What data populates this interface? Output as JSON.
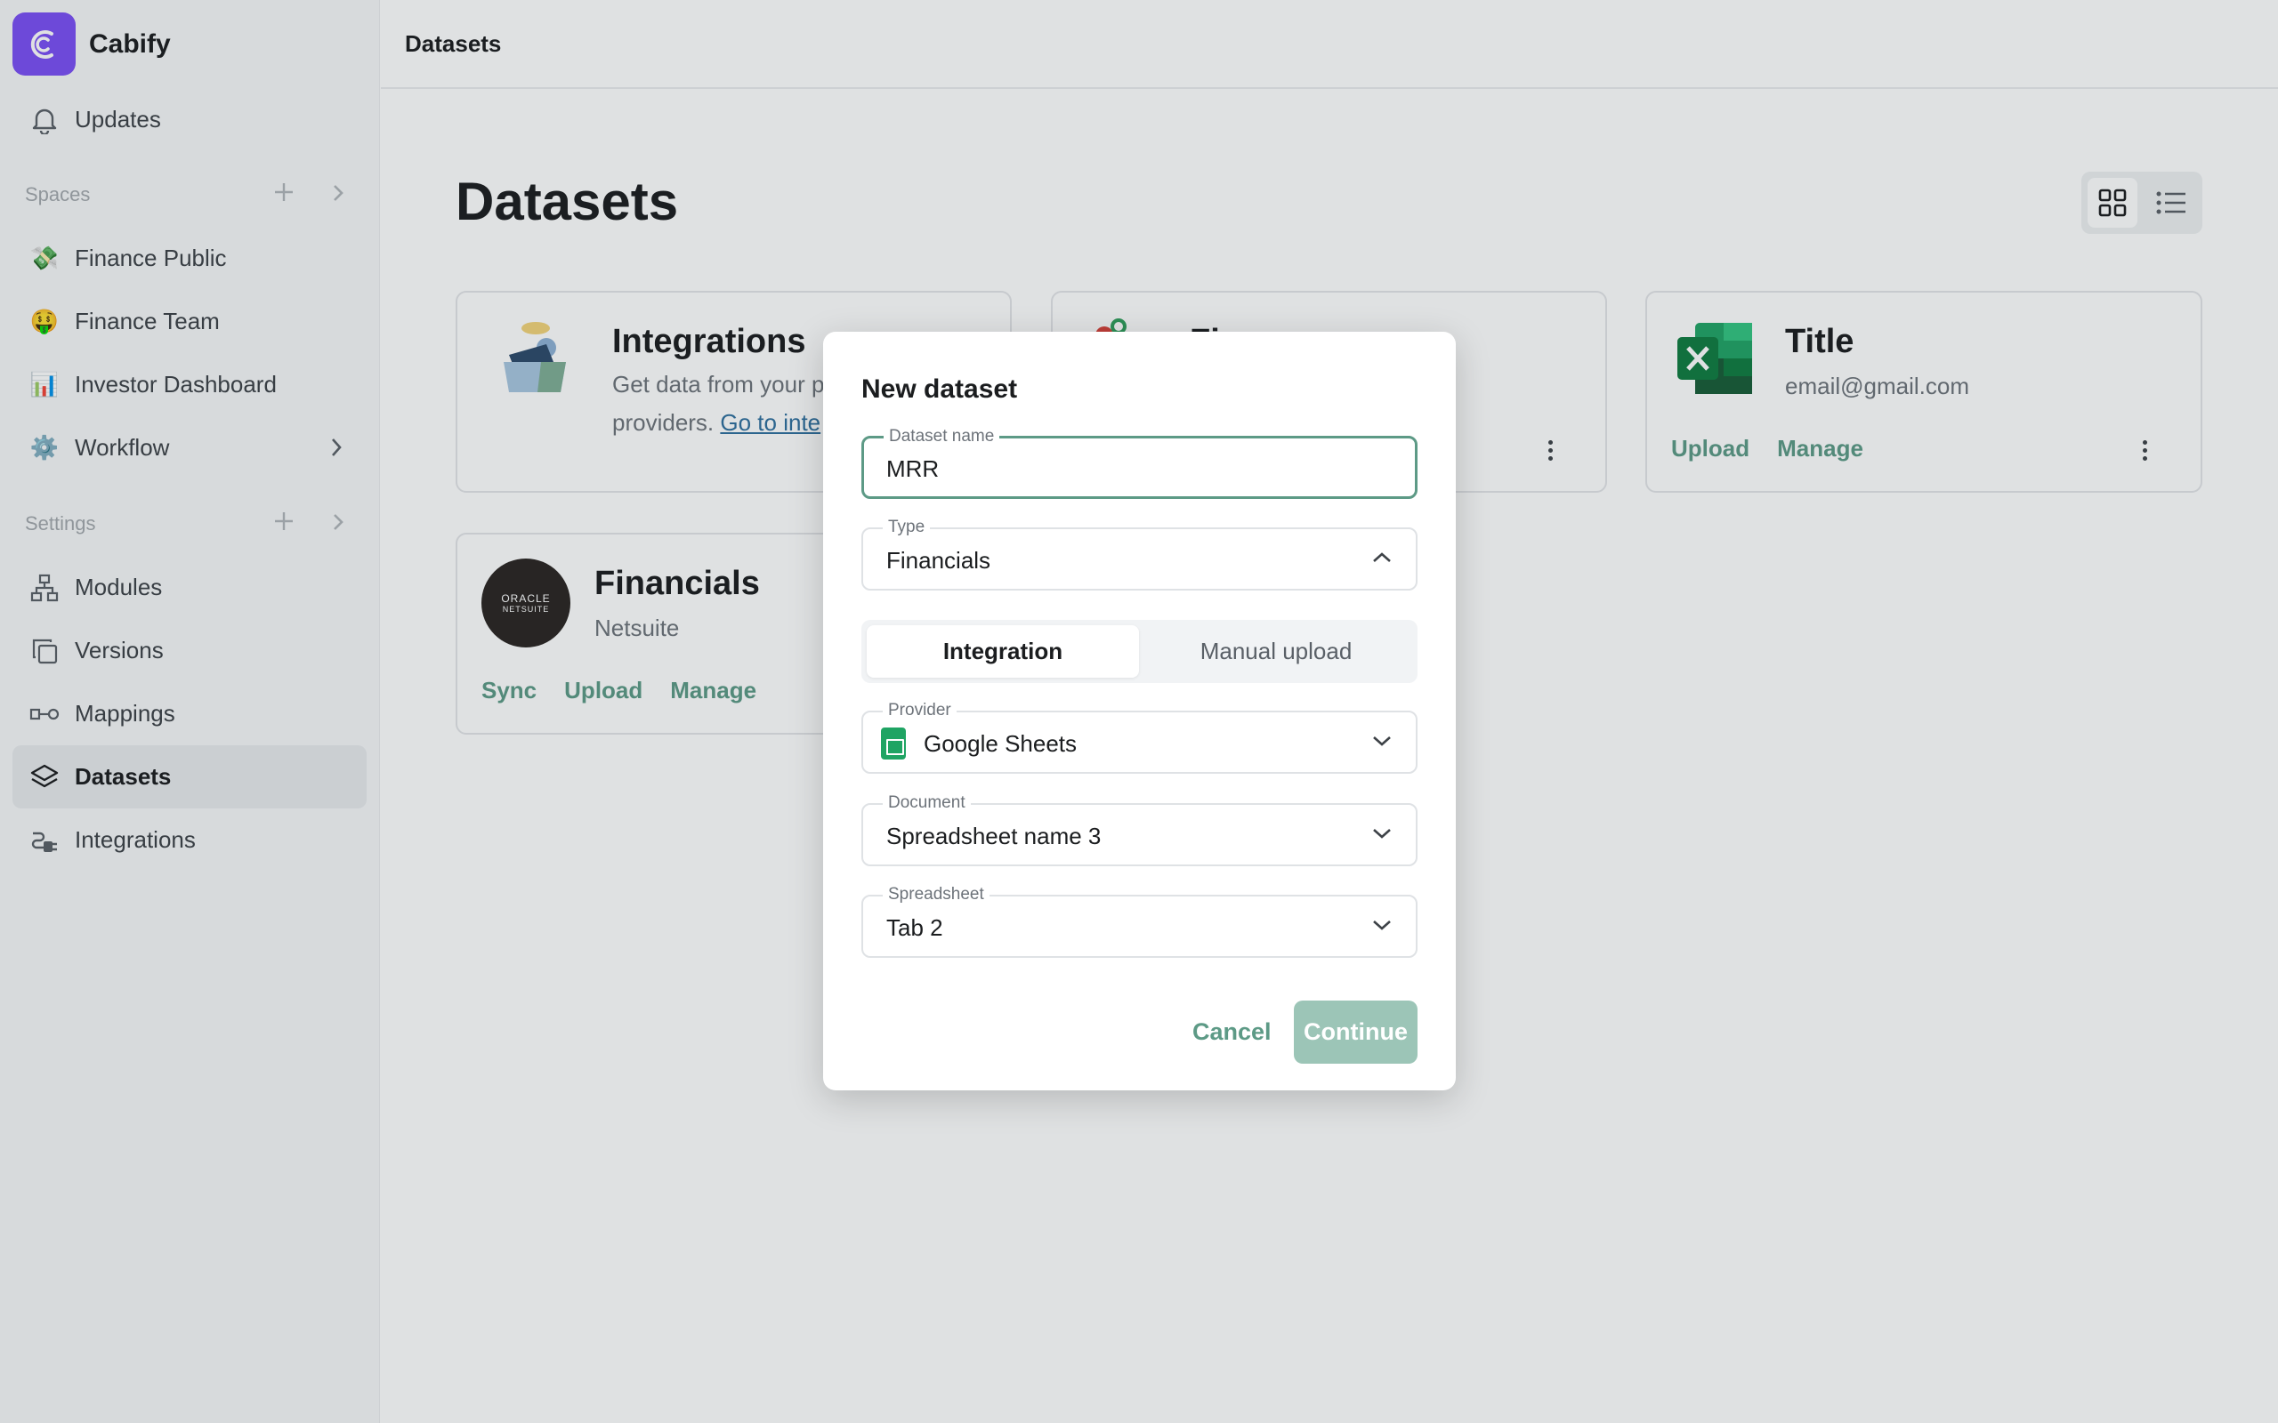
{
  "app": {
    "name": "Cabify",
    "brand_color": "#7b4ef5"
  },
  "sidebar": {
    "updates_label": "Updates",
    "spaces_heading": "Spaces",
    "spaces": [
      {
        "label": "Finance Public",
        "icon": "💸"
      },
      {
        "label": "Finance Team",
        "icon": "🤑"
      },
      {
        "label": "Investor Dashboard",
        "icon": "📊"
      },
      {
        "label": "Workflow",
        "icon": "⚙️"
      }
    ],
    "settings_heading": "Settings",
    "settings": [
      {
        "label": "Modules",
        "icon": "modules-icon"
      },
      {
        "label": "Versions",
        "icon": "versions-icon"
      },
      {
        "label": "Mappings",
        "icon": "mappings-icon"
      },
      {
        "label": "Datasets",
        "icon": "datasets-icon",
        "active": true
      },
      {
        "label": "Integrations",
        "icon": "integrations-icon"
      }
    ]
  },
  "topbar": {
    "title": "Datasets"
  },
  "page": {
    "title": "Datasets"
  },
  "cards": {
    "integrations": {
      "title": "Integrations",
      "desc_line1": "Get data from your p",
      "desc_line2": "providers. ",
      "link": "Go to inte"
    },
    "middle": {
      "title": "Fi…"
    },
    "title_card": {
      "title": "Title",
      "subtitle": "email@gmail.com",
      "actions": [
        "Upload",
        "Manage"
      ]
    },
    "financials": {
      "title": "Financials",
      "subtitle": "Netsuite",
      "logo_text_1": "ORACLE",
      "logo_text_2": "NETSUITE",
      "actions": [
        "Sync",
        "Upload",
        "Manage"
      ]
    }
  },
  "modal": {
    "title": "New dataset",
    "dataset_name": {
      "label": "Dataset name",
      "value": "MRR"
    },
    "type": {
      "label": "Type",
      "value": "Financials"
    },
    "tabs": [
      "Integration",
      "Manual upload"
    ],
    "provider": {
      "label": "Provider",
      "value": "Google Sheets"
    },
    "document": {
      "label": "Document",
      "value": "Spreadsheet name 3"
    },
    "spreadsheet": {
      "label": "Spreadsheet",
      "value": "Tab 2"
    },
    "cancel_label": "Cancel",
    "continue_label": "Continue"
  },
  "colors": {
    "accent": "#5d9a86",
    "accent_disabled": "#9cc5b7"
  }
}
